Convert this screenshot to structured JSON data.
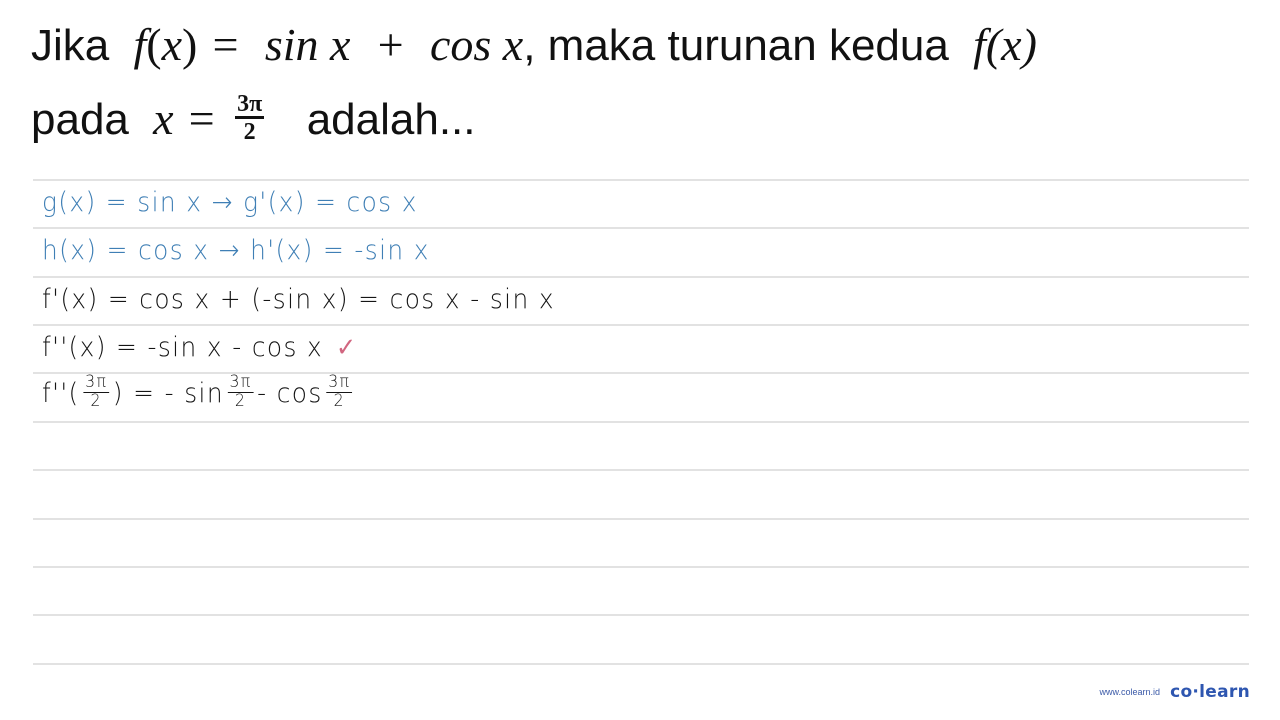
{
  "question": {
    "line1": {
      "prefix": "Jika",
      "func": "f",
      "lparen": "(",
      "var": "x",
      "rparen": ")",
      "equals": "=",
      "term1": "sin x",
      "plus": "+",
      "term2": "cos x",
      "middle": ", maka turunan kedua",
      "func2": "f(x)"
    },
    "line2": {
      "prefix": "pada",
      "var": "x",
      "equals": "=",
      "frac_num": "3π",
      "frac_den": "2",
      "suffix": "adalah..."
    }
  },
  "solution": {
    "lines": [
      {
        "text": "g(x) = sin x → g'(x) = cos x",
        "color": "#3f7fb5"
      },
      {
        "text": "h(x) = cos x → h'(x) = -sin x",
        "color": "#3f7fb5"
      },
      {
        "text": "f'(x) = cos x + (-sin x)  = cos x - sin x",
        "color": "#151515"
      },
      {
        "text": "f''(x) = -sin x - cos x",
        "color": "#151515",
        "check": "✓",
        "check_color": "#d16680"
      },
      {
        "parts": {
          "lhs_func": "f''(",
          "lhs_num": "3π",
          "lhs_den": "2",
          "lhs_close": ") = - sin",
          "arg1_num": "3π",
          "arg1_den": "2",
          "middle": "- cos",
          "arg2_num": "3π",
          "arg2_den": "2"
        },
        "color": "#151515"
      }
    ]
  },
  "brand": {
    "url": "www.colearn.id",
    "logo": "co·learn",
    "color": "#2e56b0"
  }
}
